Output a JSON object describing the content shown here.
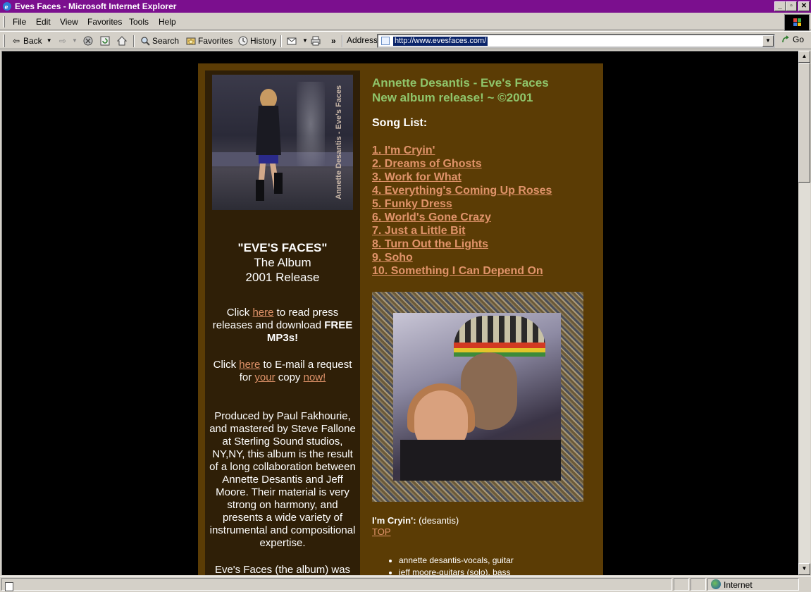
{
  "window": {
    "title": "Eves Faces - Microsoft Internet Explorer",
    "buttons": {
      "minimize": "_",
      "maximize": "▫",
      "close": "✕"
    }
  },
  "menu": {
    "items": [
      {
        "label": "File"
      },
      {
        "label": "Edit"
      },
      {
        "label": "View"
      },
      {
        "label": "Favorites"
      },
      {
        "label": "Tools"
      },
      {
        "label": "Help"
      }
    ]
  },
  "toolbar": {
    "back": "Back",
    "search": "Search",
    "favorites": "Favorites",
    "history": "History",
    "more": "»",
    "address_label": "Address",
    "url": "http://www.evesfaces.com/",
    "go": "Go"
  },
  "page": {
    "album_title": "\"EVE'S FACES\"",
    "album_line2": "The Album",
    "album_line3": "2001 Release",
    "cover_text": "Annette Desantis - Eve's Faces",
    "press_1": "Click ",
    "press_link": "here",
    "press_2": " to read press releases and download ",
    "press_bold": "FREE MP3s!",
    "email_1": "Click ",
    "email_link": "here",
    "email_2": " to E-mail a request for ",
    "email_link2": "your",
    "email_3": " copy ",
    "email_link3": "now!",
    "produced": "Produced by Paul Fakhourie, and mastered by Steve Fallone at Sterling Sound studios, NY,NY, this album is the result of a long collaboration between Annette Desantis and Jeff Moore. Their material is very strong on harmony, and presents a wide variety of instrumental and compositional expertise.",
    "album_para2": "Eve's Faces (the album) was nearly two years in the",
    "heading_line1": "Annette Desantis - Eve's Faces",
    "heading_line2": "New album release! ~ ©2001",
    "songlist_label": "Song List:",
    "songs": [
      "1. I'm Cryin'",
      "2. Dreams of Ghosts",
      "3. Work for What",
      "4. Everything's Coming Up Roses",
      "5. Funky Dress",
      "6. World's Gone Crazy",
      "7. Just a Little Bit",
      "8. Turn Out the Lights",
      "9. Soho",
      "10. Something I Can Depend On"
    ],
    "caption_title": "I'm Cryin':",
    "caption_credit": " (desantis)",
    "top_link": "TOP",
    "credits": [
      "annette desantis-vocals, guitar",
      "jeff moore-guitars (solo), bass"
    ]
  },
  "status": {
    "zone": "Internet"
  },
  "colors": {
    "titlebar": "#7b0f8e",
    "page_bg": "#5b3c05",
    "left_col_bg": "#2f1f07",
    "heading": "#8fc56b",
    "link": "#e0936a"
  }
}
